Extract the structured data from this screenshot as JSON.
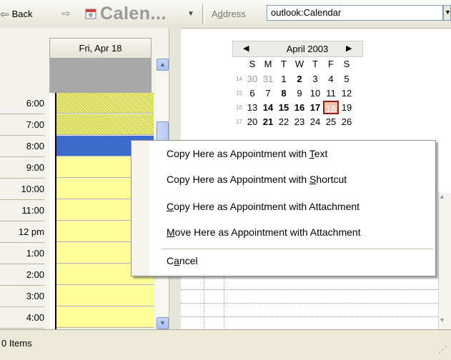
{
  "toolbar": {
    "back_label": "Back",
    "app_title": "Calen...",
    "address_label": "Address",
    "address_value": "outlook:Calendar"
  },
  "day_view": {
    "date_header": "Fri, Apr 18",
    "times": [
      "6:00",
      "7:00",
      "8:00",
      "9:00",
      "10:00",
      "11:00",
      "12 pm",
      "1:00",
      "2:00",
      "3:00",
      "4:00"
    ],
    "slot_states": [
      "tentative",
      "tentative",
      "selected",
      "free",
      "free",
      "free",
      "free",
      "free",
      "free",
      "free",
      "free"
    ]
  },
  "mini_calendar": {
    "title": "April 2003",
    "day_headers": [
      "S",
      "M",
      "T",
      "W",
      "T",
      "F",
      "S"
    ],
    "weeks": [
      {
        "wk": "14",
        "days": [
          "30",
          "31",
          "1",
          "2",
          "3",
          "4",
          "5"
        ]
      },
      {
        "wk": "15",
        "days": [
          "6",
          "7",
          "8",
          "9",
          "10",
          "11",
          "12"
        ]
      },
      {
        "wk": "16",
        "days": [
          "13",
          "14",
          "15",
          "16",
          "17",
          "18",
          "19"
        ]
      },
      {
        "wk": "17",
        "days": [
          "20",
          "21",
          "22",
          "23",
          "24",
          "25",
          "26"
        ]
      }
    ],
    "bold_days": [
      "2",
      "8",
      "14",
      "15",
      "16",
      "17",
      "21"
    ],
    "dim_days": [
      "30",
      "31"
    ],
    "today": "18"
  },
  "context_menu": {
    "items": [
      {
        "pre": "Copy Here as Appointment with ",
        "key": "T",
        "post": "ext"
      },
      {
        "pre": "Copy Here as Appointment with ",
        "key": "S",
        "post": "hortcut"
      },
      {
        "pre": "",
        "key": "C",
        "post": "opy Here as Appointment with Attachment"
      },
      {
        "pre": "",
        "key": "M",
        "post": "ove Here as Appointment with Attachment"
      },
      {
        "pre": "C",
        "key": "a",
        "post": "ncel"
      }
    ]
  },
  "status": {
    "text": "0 Items"
  },
  "colors": {
    "selected": "#3d6bcd",
    "free": "#ffff99",
    "tentative": "#e9ec7e",
    "today_border": "#8b1d1d"
  },
  "icons": [
    "back-arrow-icon",
    "forward-arrow-icon",
    "calendar-icon",
    "scroll-up-icon",
    "scroll-down-icon",
    "prev-month-icon",
    "next-month-icon",
    "resize-grip-icon"
  ]
}
